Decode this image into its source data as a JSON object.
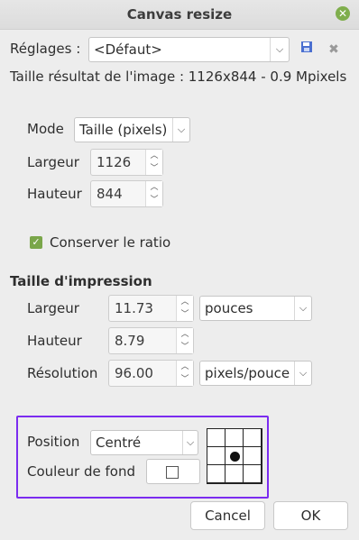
{
  "window": {
    "title": "Canvas resize"
  },
  "presets": {
    "label": "Réglages :",
    "value": "<Défaut>"
  },
  "result_info": "Taille résultat de l'image : 1126x844 - 0.9 Mpixels",
  "size": {
    "mode_label": "Mode",
    "mode_value": "Taille (pixels)",
    "width_label": "Largeur",
    "width_value": "1126",
    "height_label": "Hauteur",
    "height_value": "844",
    "keep_ratio_label": "Conserver le ratio"
  },
  "print": {
    "section_title": "Taille d'impression",
    "width_label": "Largeur",
    "width_value": "11.73",
    "width_unit": "pouces",
    "height_label": "Hauteur",
    "height_value": "8.79",
    "resolution_label": "Résolution",
    "resolution_value": "96.00",
    "resolution_unit": "pixels/pouce"
  },
  "position": {
    "label": "Position",
    "value": "Centré",
    "bg_color_label": "Couleur de fond",
    "selected_cell": "center"
  },
  "buttons": {
    "cancel": "Cancel",
    "ok": "OK"
  },
  "colors": {
    "accent_highlight": "#7b2cf0",
    "checkbox": "#7aa64a",
    "close": "#7fae4c"
  }
}
